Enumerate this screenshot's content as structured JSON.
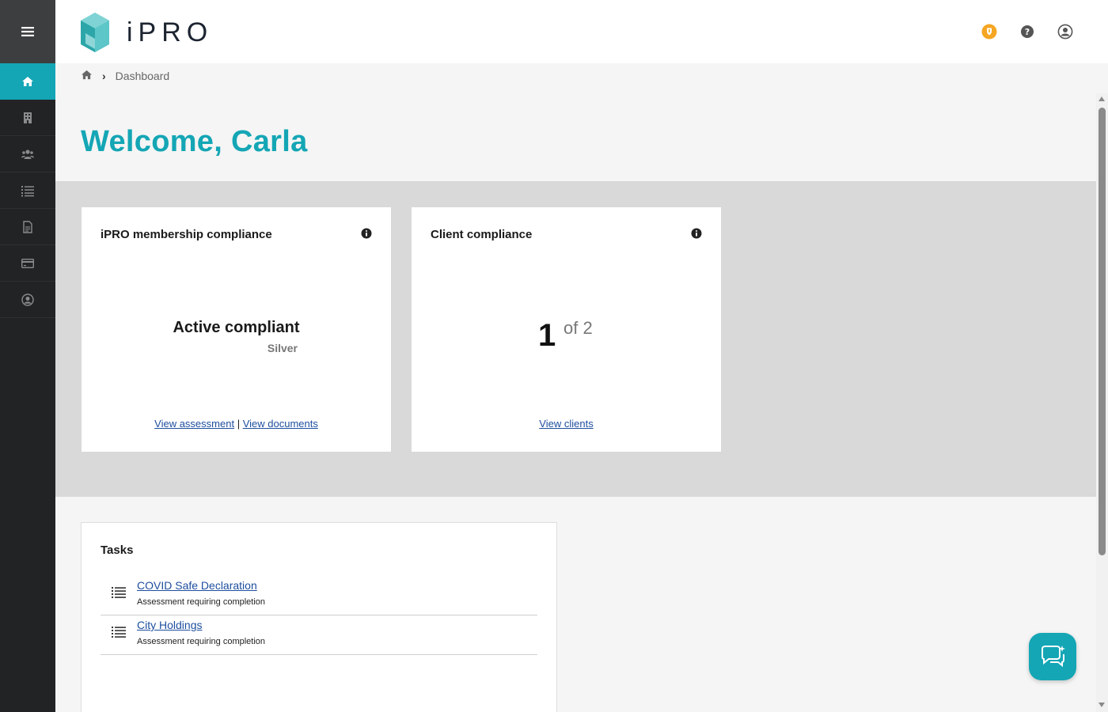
{
  "app": {
    "logo_text": "iPRO"
  },
  "sidebar": {
    "items": [
      {
        "icon": "home-icon",
        "active": true
      },
      {
        "icon": "building-icon",
        "active": false
      },
      {
        "icon": "users-icon",
        "active": false
      },
      {
        "icon": "list-icon",
        "active": false
      },
      {
        "icon": "document-icon",
        "active": false
      },
      {
        "icon": "credit-card-icon",
        "active": false
      },
      {
        "icon": "user-circle-icon",
        "active": false
      }
    ]
  },
  "header": {
    "icons": [
      "badge-icon",
      "help-icon",
      "account-icon"
    ]
  },
  "breadcrumb": {
    "current": "Dashboard"
  },
  "welcome": "Welcome, Carla",
  "membership_card": {
    "title": "iPRO membership compliance",
    "status": "Active compliant",
    "level": "Silver",
    "link_assessment": "View assessment",
    "separator": "|",
    "link_documents": "View documents"
  },
  "client_card": {
    "title": "Client compliance",
    "count": "1",
    "total": "of 2",
    "link_clients": "View clients"
  },
  "tasks": {
    "title": "Tasks",
    "items": [
      {
        "name": "COVID Safe Declaration",
        "subtitle": "Assessment requiring completion"
      },
      {
        "name": "City Holdings",
        "subtitle": "Assessment requiring completion"
      }
    ]
  },
  "colors": {
    "accent": "#14a6b5",
    "sidebar": "#222325",
    "link": "#1d4e9e",
    "badge": "#f5a623"
  }
}
